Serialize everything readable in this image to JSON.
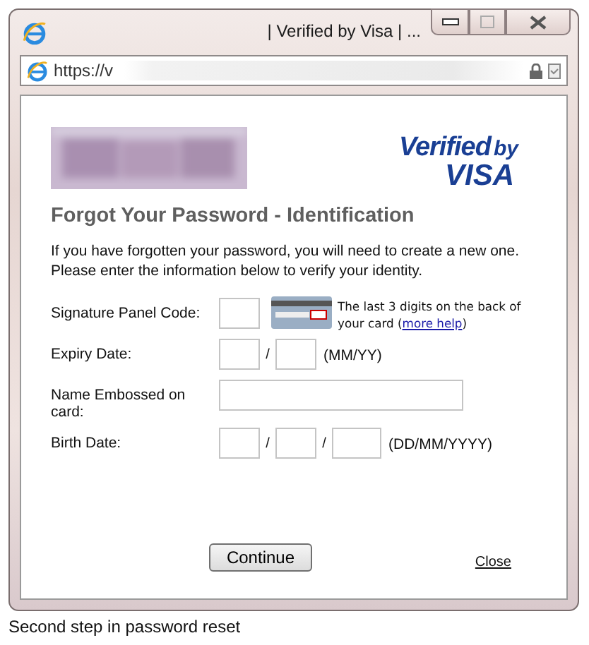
{
  "window": {
    "title": "| Verified by Visa | ..."
  },
  "address_bar": {
    "url": "https://v"
  },
  "page": {
    "logo": {
      "kind": "picture"
    },
    "brand": {
      "line1": "Verified",
      "line1_small": "by",
      "line2": "VISA"
    },
    "heading": "Forgot Your Password - Identification",
    "intro": [
      "If you have forgotten your password, you will need to create a new one.",
      "Please enter the information below to verify your identity."
    ],
    "rows": [
      {
        "label": "Signature Panel Code:",
        "parts": [
          {
            "kind": "box"
          },
          {
            "kind": "card"
          },
          {
            "kind": "help",
            "before": "The last 3 digits on the back of your card (",
            "link": "more help",
            "after": ")"
          }
        ]
      },
      {
        "label": "Expiry Date:",
        "parts": [
          {
            "kind": "box"
          },
          {
            "kind": "sep",
            "text": "/"
          },
          {
            "kind": "box"
          },
          {
            "kind": "hint",
            "text": "(MM/YY)"
          }
        ]
      },
      {
        "label": "Name Embossed on card:",
        "parts": [
          {
            "kind": "wide"
          }
        ]
      },
      {
        "label": "Birth Date:",
        "parts": [
          {
            "kind": "box"
          },
          {
            "kind": "sep",
            "text": "/"
          },
          {
            "kind": "box"
          },
          {
            "kind": "sep",
            "text": "/"
          },
          {
            "kind": "year"
          },
          {
            "kind": "hint",
            "text": "(DD/MM/YYYY)"
          }
        ]
      }
    ],
    "continue_button": "Continue",
    "close_link": "Close"
  },
  "caption": "Second step in password reset"
}
